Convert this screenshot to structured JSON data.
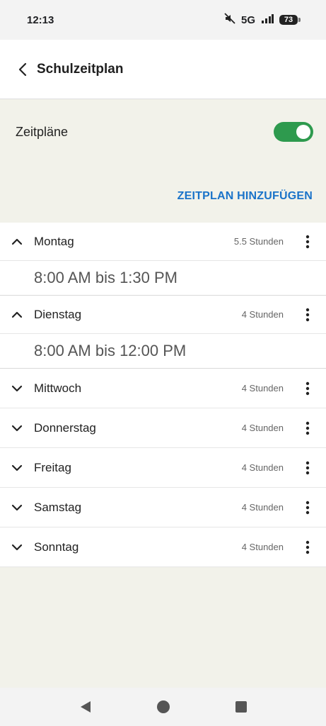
{
  "status_bar": {
    "time": "12:13",
    "network": "5G",
    "battery": "73"
  },
  "app_bar": {
    "title": "Schulzeitplan"
  },
  "settings": {
    "toggle_label": "Zeitpläne",
    "toggle_on": true,
    "add_schedule": "ZEITPLAN HINZUFÜGEN"
  },
  "days": [
    {
      "name": "Montag",
      "hours": "5.5 Stunden",
      "expanded": true,
      "time_range": "8:00 AM bis 1:30 PM"
    },
    {
      "name": "Dienstag",
      "hours": "4 Stunden",
      "expanded": true,
      "time_range": "8:00 AM bis 12:00 PM"
    },
    {
      "name": "Mittwoch",
      "hours": "4 Stunden",
      "expanded": false
    },
    {
      "name": "Donnerstag",
      "hours": "4 Stunden",
      "expanded": false
    },
    {
      "name": "Freitag",
      "hours": "4 Stunden",
      "expanded": false
    },
    {
      "name": "Samstag",
      "hours": "4 Stunden",
      "expanded": false
    },
    {
      "name": "Sonntag",
      "hours": "4 Stunden",
      "expanded": false
    }
  ],
  "colors": {
    "accent": "#1a73c9",
    "toggle": "#2e9a4e",
    "background": "#f2f2ea"
  }
}
